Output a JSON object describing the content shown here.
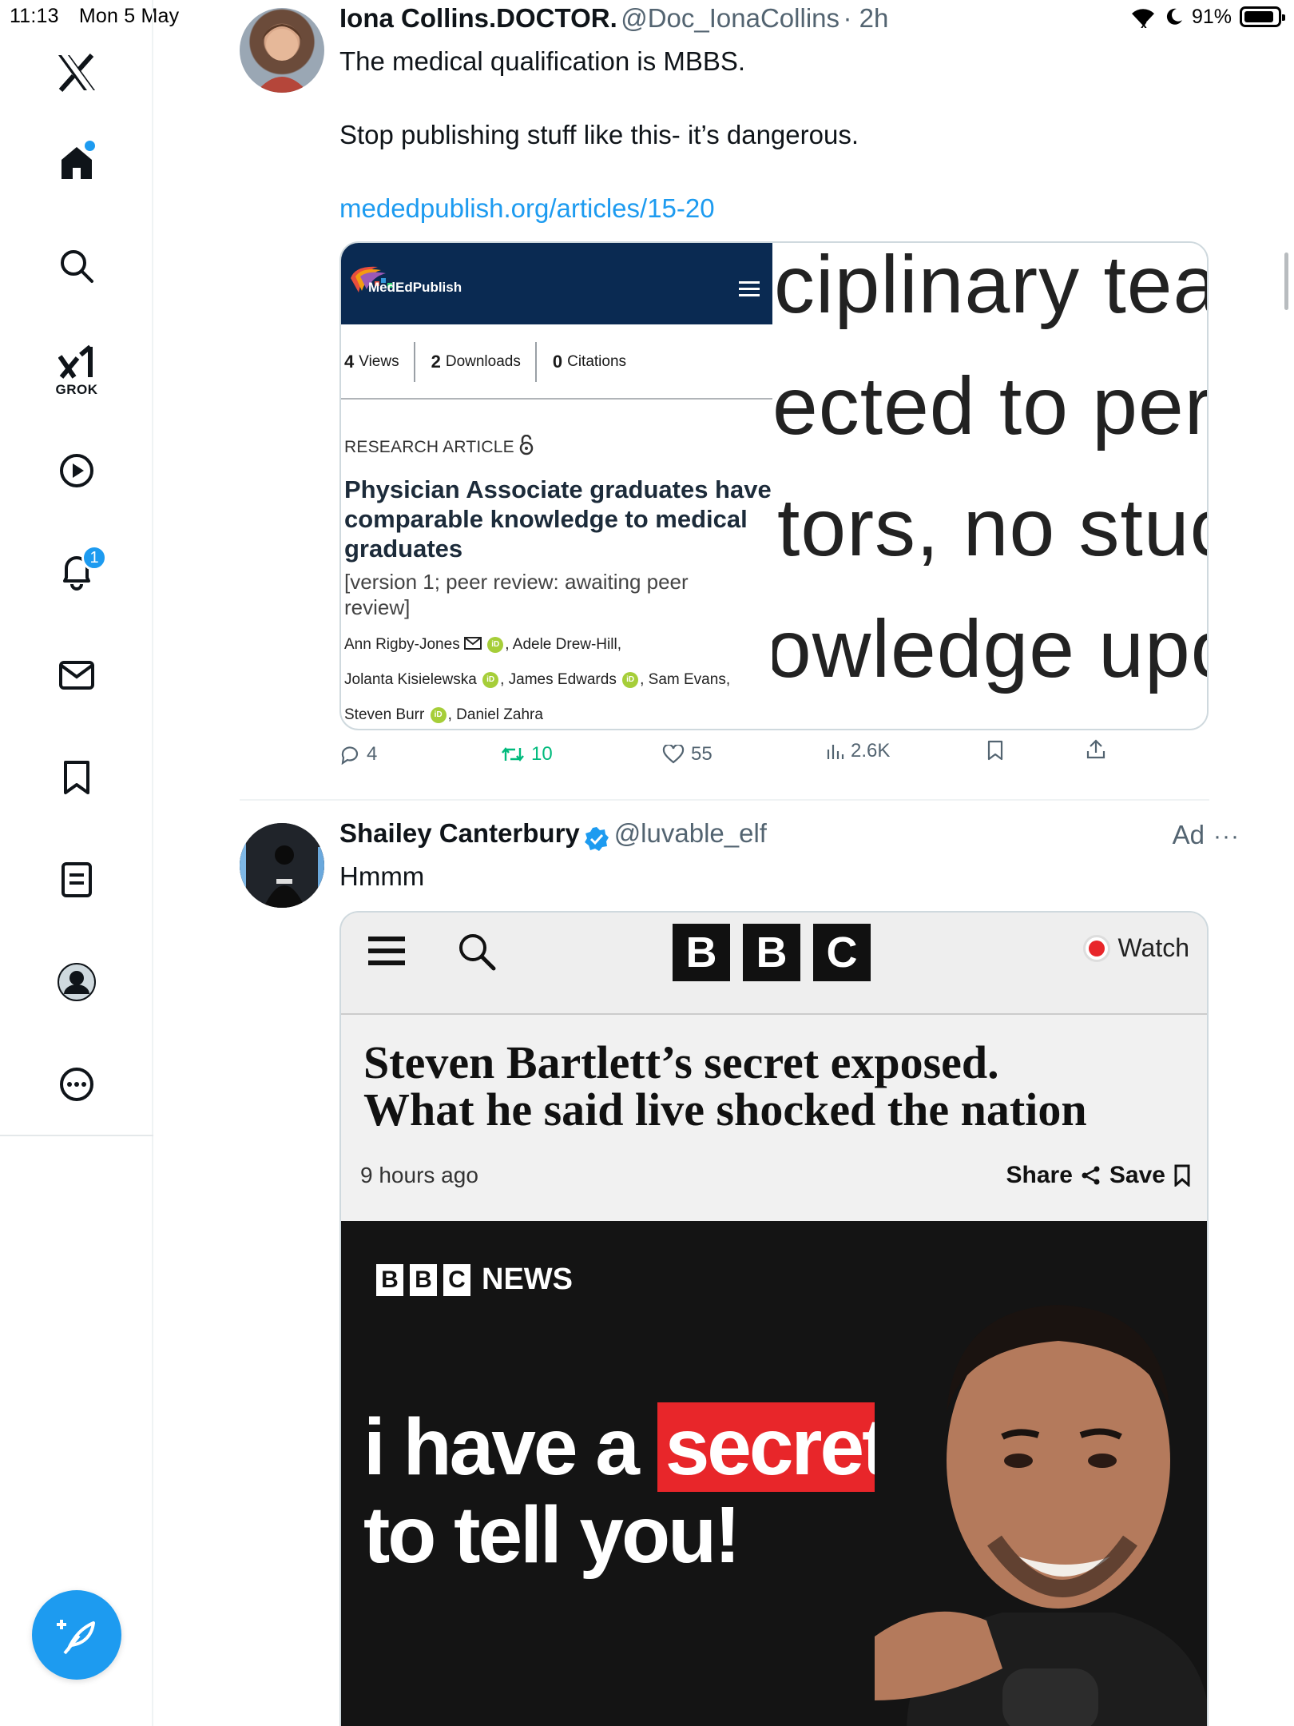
{
  "status_bar": {
    "time": "11:13",
    "date": "Mon 5 May",
    "battery": "91%",
    "battery_level": 0.91
  },
  "sidebar": {
    "items": [
      {
        "name": "home",
        "label": ""
      },
      {
        "name": "explore",
        "label": ""
      },
      {
        "name": "grok",
        "label": "GROK"
      },
      {
        "name": "video",
        "label": ""
      },
      {
        "name": "notifications",
        "label": ""
      },
      {
        "name": "messages",
        "label": ""
      },
      {
        "name": "bookmarks",
        "label": ""
      },
      {
        "name": "lists",
        "label": ""
      },
      {
        "name": "profile",
        "label": ""
      },
      {
        "name": "more",
        "label": ""
      }
    ],
    "notification_count": "1",
    "accent": "#1d9bf0"
  },
  "tweet1": {
    "name": "Iona Collins.DOCTOR.",
    "handle": "@Doc_IonaCollins",
    "time": "· 2h",
    "text_line1": "The medical qualification is MBBS.",
    "text_line2": "Stop publishing stuff like this- it’s dangerous.",
    "link": "mededpublish.org/articles/15-20",
    "card": {
      "brand": "MedEdPublish",
      "views_count": "4",
      "views_label": "Views",
      "downloads_count": "2",
      "downloads_label": "Downloads",
      "citations_count": "0",
      "citations_label": "Citations",
      "article_type": "RESEARCH ARTICLE",
      "title": "Physician Associate graduates have comparable knowledge to medical graduates",
      "version": "[version 1; peer review: awaiting peer review]",
      "authors_line1_a": "Ann Rigby-Jones",
      "authors_line1_b": ", Adele Drew-Hill,",
      "authors_line2_a": "Jolanta Kisielewska",
      "authors_line2_b": ", James Edwards",
      "authors_line2_c": ", Sam Evans,",
      "authors_line3_a": "Steven Burr",
      "authors_line3_b": ", Daniel Zahra",
      "zoom_lines": [
        "ciplinary tear",
        "ected to perfo",
        "tors, no stuc",
        "owledge upo"
      ]
    },
    "actions": {
      "replies": "4",
      "retweets": "10",
      "likes": "55",
      "views": "2.6K"
    }
  },
  "tweet2": {
    "name": "Shailey Canterbury",
    "handle": "@luvable_elf",
    "ad_label": "Ad",
    "more": "···",
    "text": "Hmmm",
    "card": {
      "watch_label": "Watch",
      "headline": "Steven Bartlett’s secret exposed.\nWhat he said live shocked the nation",
      "time": "9 hours ago",
      "share_label": "Share",
      "save_label": "Save",
      "logo_letters": [
        "B",
        "B",
        "C"
      ],
      "news_label": "NEWS",
      "image_text_a": "i have a ",
      "image_text_highlight": "secret",
      "image_text_b": "to tell you!"
    }
  }
}
